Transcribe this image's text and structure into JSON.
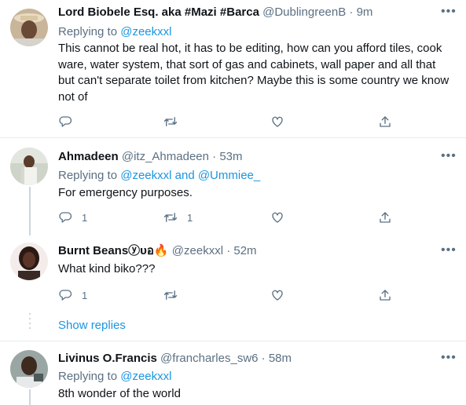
{
  "icons": {
    "more": "more-horizontal-icon",
    "reply": "reply-icon",
    "retweet": "retweet-icon",
    "like": "like-icon",
    "share": "share-icon"
  },
  "colors": {
    "accent": "#1b95e0",
    "secondary_text": "#5b7083",
    "primary_text": "#0f1419",
    "divider": "#e6ecf0"
  },
  "tweets": [
    {
      "name": "Lord Biobele Esq. aka #Mazi #Barca",
      "handle": "@DublingreenB",
      "separator": "·",
      "time": "9m",
      "replying_prefix": "Replying to",
      "mentions": "@zeekxxl",
      "text": "This cannot be real hot, it has to be editing, how can you afford tiles, cook ware, water system, that sort of gas and cabinets, wall paper and all that but can't separate toilet from kitchen? Maybe this is some country we know not of",
      "reply_count": "",
      "retweet_count": "",
      "like_count": ""
    },
    {
      "name": "Ahmadeen",
      "handle": "@itz_Ahmadeen",
      "separator": "·",
      "time": "53m",
      "replying_prefix": "Replying to",
      "mentions": "@zeekxxl and @Ummiee_",
      "text": "For emergency purposes.",
      "reply_count": "1",
      "retweet_count": "1",
      "like_count": ""
    },
    {
      "name": "Burnt Beansⓨυอ🔥",
      "handle": "@zeekxxl",
      "separator": "·",
      "time": "52m",
      "text": "What kind biko???",
      "reply_count": "1",
      "retweet_count": "",
      "like_count": ""
    },
    {
      "name": "Livinus O.Francis",
      "handle": "@francharles_sw6",
      "separator": "·",
      "time": "58m",
      "replying_prefix": "Replying to",
      "mentions": "@zeekxxl",
      "text": "8th wonder of the world"
    }
  ],
  "show_replies": "Show replies"
}
